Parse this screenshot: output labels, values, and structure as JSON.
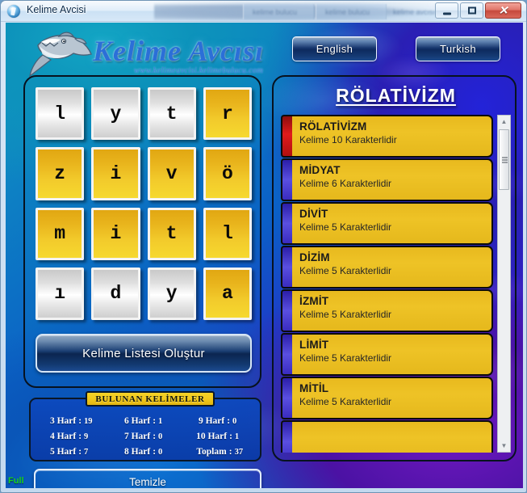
{
  "window": {
    "title": "Kelime Avcisi",
    "controls": {
      "minimize": "minimize-icon",
      "maximize": "maximize-icon",
      "close": "✕"
    }
  },
  "logo": {
    "wordmark": "Kelime Avcısı",
    "url": "www.kelimeavcisi.kelimebulucu.com",
    "icon": "shark-icon"
  },
  "language": {
    "english_label": "English",
    "turkish_label": "Turkish"
  },
  "letters": {
    "tiles": [
      {
        "letter": "l",
        "style": "silver"
      },
      {
        "letter": "y",
        "style": "silver"
      },
      {
        "letter": "t",
        "style": "silver"
      },
      {
        "letter": "r",
        "style": "gold"
      },
      {
        "letter": "z",
        "style": "gold"
      },
      {
        "letter": "i",
        "style": "gold"
      },
      {
        "letter": "v",
        "style": "gold"
      },
      {
        "letter": "ö",
        "style": "gold"
      },
      {
        "letter": "m",
        "style": "gold"
      },
      {
        "letter": "i",
        "style": "gold"
      },
      {
        "letter": "t",
        "style": "gold"
      },
      {
        "letter": "l",
        "style": "gold"
      },
      {
        "letter": "ı",
        "style": "silver"
      },
      {
        "letter": "d",
        "style": "silver"
      },
      {
        "letter": "y",
        "style": "silver"
      },
      {
        "letter": "a",
        "style": "gold"
      }
    ],
    "create_button_label": "Kelime Listesi Oluştur"
  },
  "stats": {
    "title": "BULUNAN KELİMELER",
    "items": [
      {
        "label": "3 Harf",
        "sep": ":",
        "value": "19"
      },
      {
        "label": "6 Harf",
        "sep": ":",
        "value": "1"
      },
      {
        "label": "9 Harf",
        "sep": ":",
        "value": "0"
      },
      {
        "label": "4 Harf",
        "sep": ":",
        "value": "9"
      },
      {
        "label": "7 Harf",
        "sep": ":",
        "value": "0"
      },
      {
        "label": "10 Harf",
        "sep": ":",
        "value": "1"
      },
      {
        "label": "5 Harf",
        "sep": ":",
        "value": "7"
      },
      {
        "label": "8 Harf",
        "sep": ":",
        "value": "0"
      },
      {
        "label": "Toplam",
        "sep": ":",
        "value": "37"
      }
    ]
  },
  "clear_button_label": "Temizle",
  "status_tag": "Full",
  "results": {
    "title": "RÖLATİVİZM",
    "rows": [
      {
        "word": "RÖLATİVİZM",
        "detail": "Kelime 10 Karakterlidir",
        "selected": true
      },
      {
        "word": "MİDYAT",
        "detail": "Kelime 6 Karakterlidir",
        "selected": false
      },
      {
        "word": "DİVİT",
        "detail": "Kelime 5 Karakterlidir",
        "selected": false
      },
      {
        "word": "DİZİM",
        "detail": "Kelime 5 Karakterlidir",
        "selected": false
      },
      {
        "word": "İZMİT",
        "detail": "Kelime 5 Karakterlidir",
        "selected": false
      },
      {
        "word": "LİMİT",
        "detail": "Kelime 5 Karakterlidir",
        "selected": false
      },
      {
        "word": "MİTİL",
        "detail": "Kelime 5 Karakterlidir",
        "selected": false
      },
      {
        "word": "",
        "detail": "",
        "selected": false
      }
    ],
    "scroll_up_icon": "▲",
    "scroll_down_icon": "▼"
  },
  "colors": {
    "tile_gold": "#eec326",
    "tile_silver": "#ffffff",
    "accent_selected": "#e01b1b",
    "accent_normal": "#5a4fe0",
    "panel_border": "#07121f",
    "stats_bg": "#0d49be",
    "status_tag": "#19d21f"
  }
}
